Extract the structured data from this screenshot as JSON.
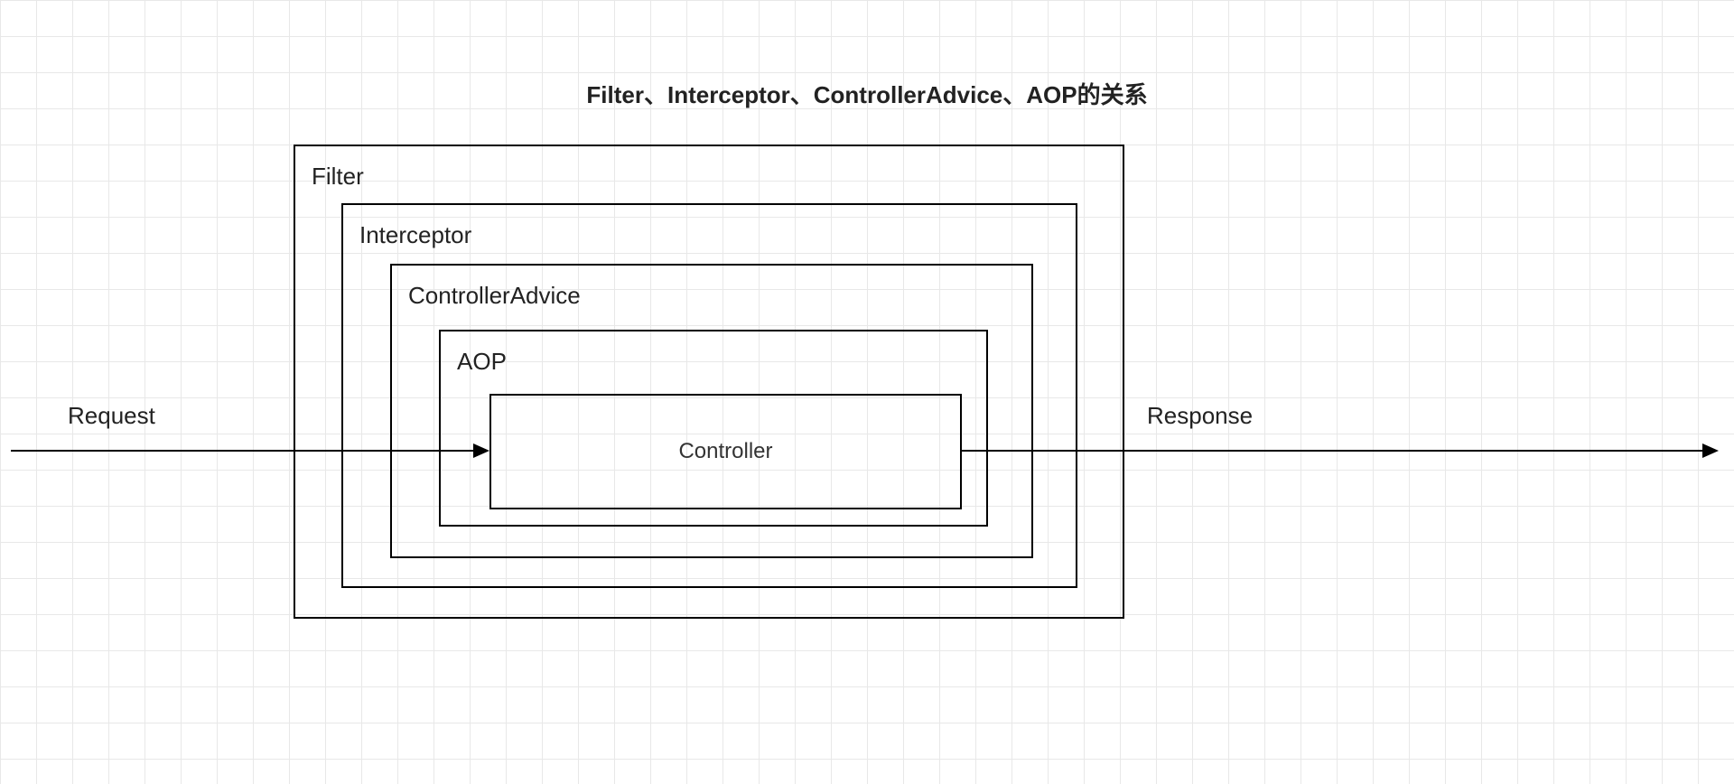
{
  "title": "Filter、Interceptor、ControllerAdvice、AOP的关系",
  "layers": {
    "filter": "Filter",
    "interceptor": "Interceptor",
    "controllerAdvice": "ControllerAdvice",
    "aop": "AOP",
    "controller": "Controller"
  },
  "flow": {
    "request": "Request",
    "response": "Response"
  }
}
